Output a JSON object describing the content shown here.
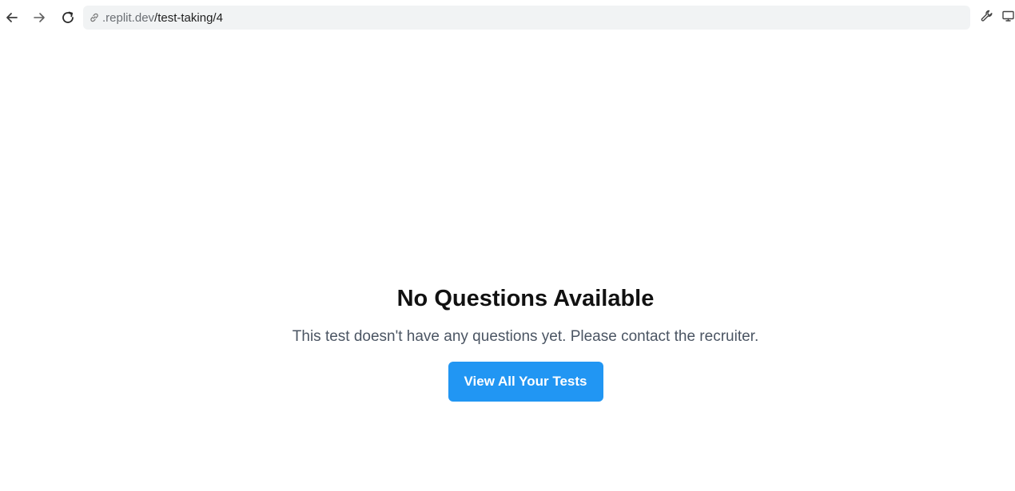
{
  "browser": {
    "url_host": ".replit.dev",
    "url_path": "/test-taking/4",
    "icons": [
      "back-arrow-icon",
      "forward-arrow-icon",
      "reload-icon",
      "link-icon",
      "wrench-icon",
      "screen-icon"
    ]
  },
  "main": {
    "title": "No Questions Available",
    "message": "This test doesn't have any questions yet. Please contact the recruiter.",
    "button_label": "View All Your Tests"
  },
  "colors": {
    "primary_button": "#2196f3",
    "address_bar_bg": "#f1f3f4",
    "title_text": "#111111",
    "message_text": "#4b5563"
  }
}
